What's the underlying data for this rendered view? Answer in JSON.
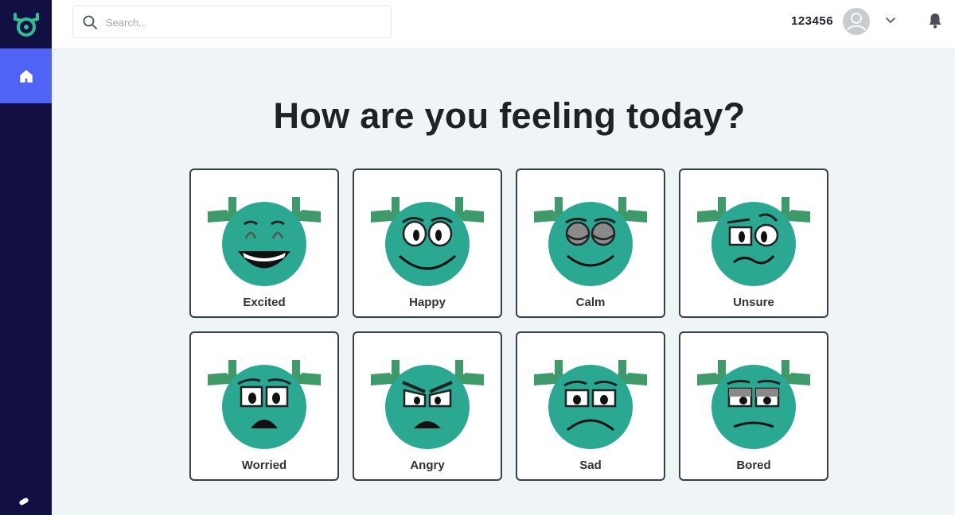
{
  "search": {
    "placeholder": "Search..."
  },
  "header": {
    "user_id": "123456"
  },
  "main": {
    "title": "How are you feeling today?"
  },
  "moods": [
    {
      "label": "Excited",
      "icon": "excited-face-icon"
    },
    {
      "label": "Happy",
      "icon": "happy-face-icon"
    },
    {
      "label": "Calm",
      "icon": "calm-face-icon"
    },
    {
      "label": "Unsure",
      "icon": "unsure-face-icon"
    },
    {
      "label": "Worried",
      "icon": "worried-face-icon"
    },
    {
      "label": "Angry",
      "icon": "angry-face-icon"
    },
    {
      "label": "Sad",
      "icon": "sad-face-icon"
    },
    {
      "label": "Bored",
      "icon": "bored-face-icon"
    }
  ],
  "colors": {
    "sidebar": "#121043",
    "accent": "#4f64f5",
    "face_green": "#2aa891",
    "antler_green": "#3f9a6a",
    "background": "#eff4f7"
  }
}
